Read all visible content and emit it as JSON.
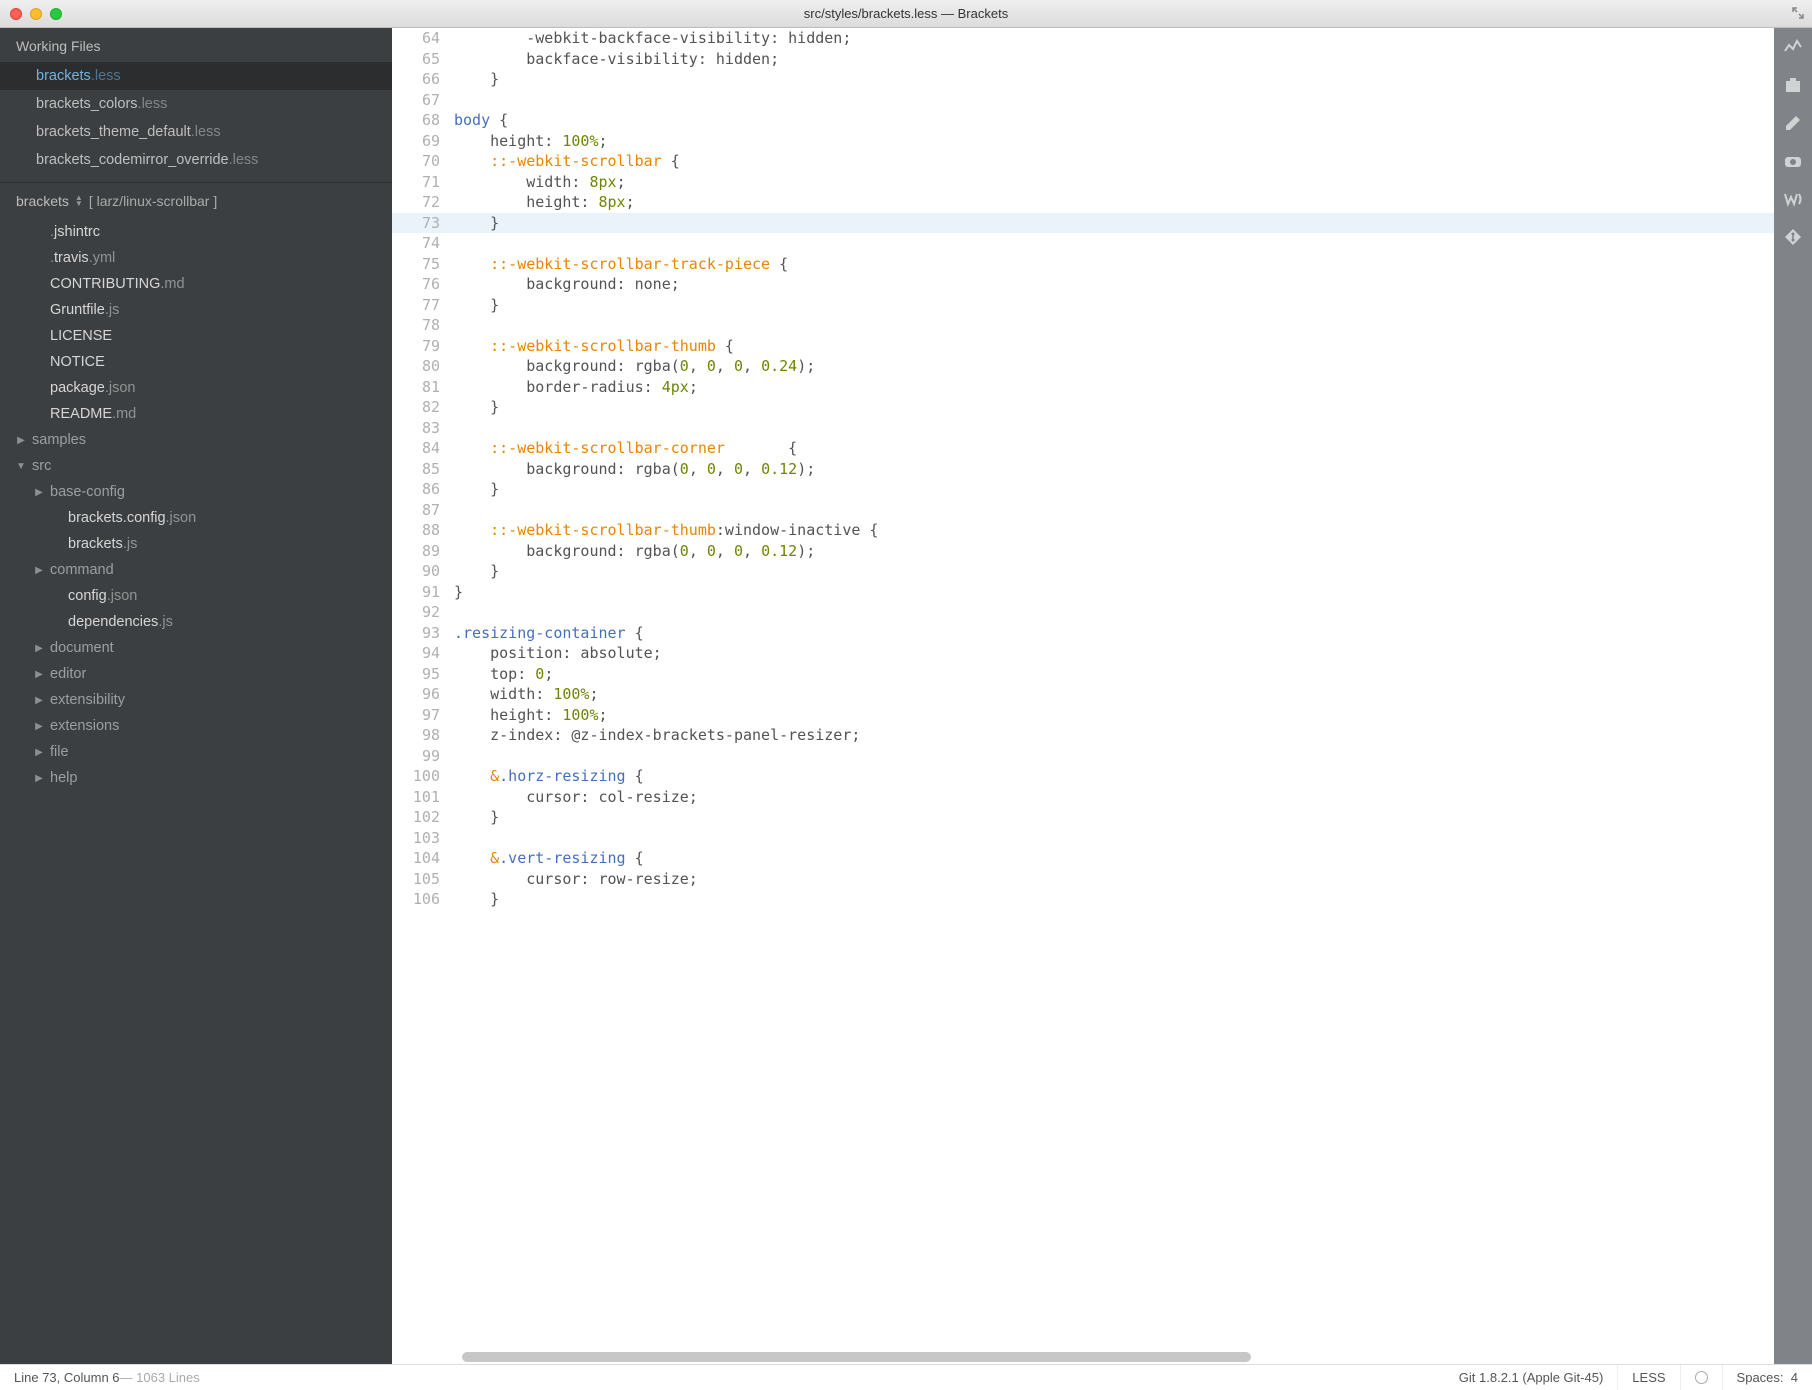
{
  "window": {
    "title": "src/styles/brackets.less — Brackets"
  },
  "sidebar": {
    "working_files_label": "Working Files",
    "working_files": [
      {
        "pre": "",
        "name": "brackets",
        "ext": ".less",
        "active": true
      },
      {
        "pre": "",
        "name": "brackets_colors",
        "ext": ".less",
        "active": false
      },
      {
        "pre": "",
        "name": "brackets_theme_default",
        "ext": ".less",
        "active": false
      },
      {
        "pre": "",
        "name": "brackets_codemirror_override",
        "ext": ".less",
        "active": false
      }
    ],
    "project_name": "brackets",
    "branch": "[ larz/linux-scrollbar ]",
    "tree": [
      {
        "depth": 1,
        "kind": "file",
        "pre": ".",
        "name": "jshintrc",
        "ext": ""
      },
      {
        "depth": 1,
        "kind": "file",
        "pre": ".",
        "name": "travis",
        "ext": ".yml"
      },
      {
        "depth": 1,
        "kind": "file",
        "pre": "",
        "name": "CONTRIBUTING",
        "ext": ".md"
      },
      {
        "depth": 1,
        "kind": "file",
        "pre": "",
        "name": "Gruntfile",
        "ext": ".js"
      },
      {
        "depth": 1,
        "kind": "file",
        "pre": "",
        "name": "LICENSE",
        "ext": ""
      },
      {
        "depth": 1,
        "kind": "file",
        "pre": "",
        "name": "NOTICE",
        "ext": ""
      },
      {
        "depth": 1,
        "kind": "file",
        "pre": "",
        "name": "package",
        "ext": ".json"
      },
      {
        "depth": 1,
        "kind": "file",
        "pre": "",
        "name": "README",
        "ext": ".md"
      },
      {
        "depth": 0,
        "kind": "folder",
        "disc": "▶",
        "name": "samples",
        "ext": ""
      },
      {
        "depth": 0,
        "kind": "folder",
        "disc": "▼",
        "name": "src",
        "ext": ""
      },
      {
        "depth": 1,
        "kind": "folder",
        "disc": "▶",
        "name": "base-config",
        "ext": ""
      },
      {
        "depth": 2,
        "kind": "file",
        "pre": "",
        "name": "brackets.config",
        "ext": ".json"
      },
      {
        "depth": 2,
        "kind": "file",
        "pre": "",
        "name": "brackets",
        "ext": ".js"
      },
      {
        "depth": 1,
        "kind": "folder",
        "disc": "▶",
        "name": "command",
        "ext": ""
      },
      {
        "depth": 2,
        "kind": "file",
        "pre": "",
        "name": "config",
        "ext": ".json"
      },
      {
        "depth": 2,
        "kind": "file",
        "pre": "",
        "name": "dependencies",
        "ext": ".js"
      },
      {
        "depth": 1,
        "kind": "folder",
        "disc": "▶",
        "name": "document",
        "ext": ""
      },
      {
        "depth": 1,
        "kind": "folder",
        "disc": "▶",
        "name": "editor",
        "ext": ""
      },
      {
        "depth": 1,
        "kind": "folder",
        "disc": "▶",
        "name": "extensibility",
        "ext": ""
      },
      {
        "depth": 1,
        "kind": "folder",
        "disc": "▶",
        "name": "extensions",
        "ext": ""
      },
      {
        "depth": 1,
        "kind": "folder",
        "disc": "▶",
        "name": "file",
        "ext": ""
      },
      {
        "depth": 1,
        "kind": "folder",
        "disc": "▶",
        "name": "help",
        "ext": ""
      }
    ]
  },
  "editor": {
    "highlight_line": 73,
    "lines": [
      {
        "n": 64,
        "tokens": [
          {
            "t": "        -webkit-backface-visibility: hidden;",
            "c": ""
          }
        ]
      },
      {
        "n": 65,
        "tokens": [
          {
            "t": "        backface-visibility: hidden;",
            "c": ""
          }
        ]
      },
      {
        "n": 66,
        "tokens": [
          {
            "t": "    }",
            "c": ""
          }
        ]
      },
      {
        "n": 67,
        "tokens": [
          {
            "t": "",
            "c": ""
          }
        ]
      },
      {
        "n": 68,
        "tokens": [
          {
            "t": "body",
            "c": "c-kw"
          },
          {
            "t": " {",
            "c": ""
          }
        ]
      },
      {
        "n": 69,
        "tokens": [
          {
            "t": "    height: ",
            "c": ""
          },
          {
            "t": "100%",
            "c": "c-num"
          },
          {
            "t": ";",
            "c": ""
          }
        ]
      },
      {
        "n": 70,
        "tokens": [
          {
            "t": "    ",
            "c": ""
          },
          {
            "t": "::-webkit-scrollbar",
            "c": "c-sel"
          },
          {
            "t": " {",
            "c": ""
          }
        ]
      },
      {
        "n": 71,
        "tokens": [
          {
            "t": "        width: ",
            "c": ""
          },
          {
            "t": "8px",
            "c": "c-num"
          },
          {
            "t": ";",
            "c": ""
          }
        ]
      },
      {
        "n": 72,
        "tokens": [
          {
            "t": "        height: ",
            "c": ""
          },
          {
            "t": "8px",
            "c": "c-num"
          },
          {
            "t": ";",
            "c": ""
          }
        ]
      },
      {
        "n": 73,
        "tokens": [
          {
            "t": "    }",
            "c": ""
          }
        ]
      },
      {
        "n": 74,
        "tokens": [
          {
            "t": "",
            "c": ""
          }
        ]
      },
      {
        "n": 75,
        "tokens": [
          {
            "t": "    ",
            "c": ""
          },
          {
            "t": "::-webkit-scrollbar-track-piece",
            "c": "c-sel"
          },
          {
            "t": " {",
            "c": ""
          }
        ]
      },
      {
        "n": 76,
        "tokens": [
          {
            "t": "        background: none;",
            "c": ""
          }
        ]
      },
      {
        "n": 77,
        "tokens": [
          {
            "t": "    }",
            "c": ""
          }
        ]
      },
      {
        "n": 78,
        "tokens": [
          {
            "t": "",
            "c": ""
          }
        ]
      },
      {
        "n": 79,
        "tokens": [
          {
            "t": "    ",
            "c": ""
          },
          {
            "t": "::-webkit-scrollbar-thumb",
            "c": "c-sel"
          },
          {
            "t": " {",
            "c": ""
          }
        ]
      },
      {
        "n": 80,
        "tokens": [
          {
            "t": "        background: rgba(",
            "c": ""
          },
          {
            "t": "0",
            "c": "c-num"
          },
          {
            "t": ", ",
            "c": ""
          },
          {
            "t": "0",
            "c": "c-num"
          },
          {
            "t": ", ",
            "c": ""
          },
          {
            "t": "0",
            "c": "c-num"
          },
          {
            "t": ", ",
            "c": ""
          },
          {
            "t": "0.24",
            "c": "c-num"
          },
          {
            "t": ");",
            "c": ""
          }
        ]
      },
      {
        "n": 81,
        "tokens": [
          {
            "t": "        border-radius: ",
            "c": ""
          },
          {
            "t": "4px",
            "c": "c-num"
          },
          {
            "t": ";",
            "c": ""
          }
        ]
      },
      {
        "n": 82,
        "tokens": [
          {
            "t": "    }",
            "c": ""
          }
        ]
      },
      {
        "n": 83,
        "tokens": [
          {
            "t": "",
            "c": ""
          }
        ]
      },
      {
        "n": 84,
        "tokens": [
          {
            "t": "    ",
            "c": ""
          },
          {
            "t": "::-webkit-scrollbar-corner",
            "c": "c-sel"
          },
          {
            "t": "       {",
            "c": ""
          }
        ]
      },
      {
        "n": 85,
        "tokens": [
          {
            "t": "        background: rgba(",
            "c": ""
          },
          {
            "t": "0",
            "c": "c-num"
          },
          {
            "t": ", ",
            "c": ""
          },
          {
            "t": "0",
            "c": "c-num"
          },
          {
            "t": ", ",
            "c": ""
          },
          {
            "t": "0",
            "c": "c-num"
          },
          {
            "t": ", ",
            "c": ""
          },
          {
            "t": "0.12",
            "c": "c-num"
          },
          {
            "t": ");",
            "c": ""
          }
        ]
      },
      {
        "n": 86,
        "tokens": [
          {
            "t": "    }",
            "c": ""
          }
        ]
      },
      {
        "n": 87,
        "tokens": [
          {
            "t": "",
            "c": ""
          }
        ]
      },
      {
        "n": 88,
        "tokens": [
          {
            "t": "    ",
            "c": ""
          },
          {
            "t": "::-webkit-scrollbar-thumb",
            "c": "c-sel"
          },
          {
            "t": ":window-inactive {",
            "c": ""
          }
        ]
      },
      {
        "n": 89,
        "tokens": [
          {
            "t": "        background: rgba(",
            "c": ""
          },
          {
            "t": "0",
            "c": "c-num"
          },
          {
            "t": ", ",
            "c": ""
          },
          {
            "t": "0",
            "c": "c-num"
          },
          {
            "t": ", ",
            "c": ""
          },
          {
            "t": "0",
            "c": "c-num"
          },
          {
            "t": ", ",
            "c": ""
          },
          {
            "t": "0.12",
            "c": "c-num"
          },
          {
            "t": ");",
            "c": ""
          }
        ]
      },
      {
        "n": 90,
        "tokens": [
          {
            "t": "    }",
            "c": ""
          }
        ]
      },
      {
        "n": 91,
        "tokens": [
          {
            "t": "}",
            "c": ""
          }
        ]
      },
      {
        "n": 92,
        "tokens": [
          {
            "t": "",
            "c": ""
          }
        ]
      },
      {
        "n": 93,
        "tokens": [
          {
            "t": ".resizing-container",
            "c": "c-cls"
          },
          {
            "t": " {",
            "c": ""
          }
        ]
      },
      {
        "n": 94,
        "tokens": [
          {
            "t": "    position: absolute;",
            "c": ""
          }
        ]
      },
      {
        "n": 95,
        "tokens": [
          {
            "t": "    top: ",
            "c": ""
          },
          {
            "t": "0",
            "c": "c-num"
          },
          {
            "t": ";",
            "c": ""
          }
        ]
      },
      {
        "n": 96,
        "tokens": [
          {
            "t": "    width: ",
            "c": ""
          },
          {
            "t": "100%",
            "c": "c-num"
          },
          {
            "t": ";",
            "c": ""
          }
        ]
      },
      {
        "n": 97,
        "tokens": [
          {
            "t": "    height: ",
            "c": ""
          },
          {
            "t": "100%",
            "c": "c-num"
          },
          {
            "t": ";",
            "c": ""
          }
        ]
      },
      {
        "n": 98,
        "tokens": [
          {
            "t": "    z-index: @z-index-brackets-panel-resizer;",
            "c": ""
          }
        ]
      },
      {
        "n": 99,
        "tokens": [
          {
            "t": "",
            "c": ""
          }
        ]
      },
      {
        "n": 100,
        "tokens": [
          {
            "t": "    ",
            "c": ""
          },
          {
            "t": "&",
            "c": "c-sel"
          },
          {
            "t": ".horz-resizing",
            "c": "c-cls"
          },
          {
            "t": " {",
            "c": ""
          }
        ]
      },
      {
        "n": 101,
        "tokens": [
          {
            "t": "        cursor: col-resize;",
            "c": ""
          }
        ]
      },
      {
        "n": 102,
        "tokens": [
          {
            "t": "    }",
            "c": ""
          }
        ]
      },
      {
        "n": 103,
        "tokens": [
          {
            "t": "",
            "c": ""
          }
        ]
      },
      {
        "n": 104,
        "tokens": [
          {
            "t": "    ",
            "c": ""
          },
          {
            "t": "&",
            "c": "c-sel"
          },
          {
            "t": ".vert-resizing",
            "c": "c-cls"
          },
          {
            "t": " {",
            "c": ""
          }
        ]
      },
      {
        "n": 105,
        "tokens": [
          {
            "t": "        cursor: row-resize;",
            "c": ""
          }
        ]
      },
      {
        "n": 106,
        "tokens": [
          {
            "t": "    }",
            "c": ""
          }
        ]
      }
    ]
  },
  "statusbar": {
    "cursor": "Line 73, Column 6",
    "total": " — 1063 Lines",
    "git": "Git 1.8.2.1 (Apple Git-45)",
    "mode": "LESS",
    "indent_label": "Spaces:",
    "indent_value": "4"
  },
  "right_rail": [
    "live-preview-icon",
    "extension-manager-icon",
    "edit-icon",
    "camera-icon",
    "w3c-icon",
    "git-icon"
  ]
}
